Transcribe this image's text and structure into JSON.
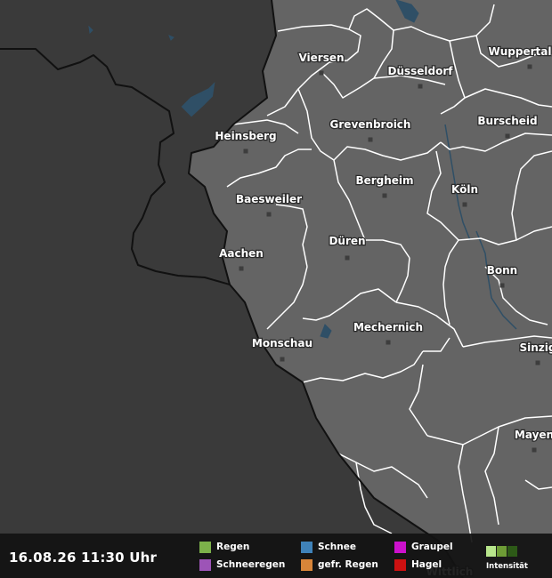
{
  "map": {
    "cities": [
      {
        "name": "Viersen"
      },
      {
        "name": "Düsseldorf"
      },
      {
        "name": "Wuppertal"
      },
      {
        "name": "Heinsberg"
      },
      {
        "name": "Grevenbroich"
      },
      {
        "name": "Burscheid"
      },
      {
        "name": "Bergheim"
      },
      {
        "name": "Baesweiler"
      },
      {
        "name": "Köln"
      },
      {
        "name": "Düren"
      },
      {
        "name": "Aachen"
      },
      {
        "name": "Bonn"
      },
      {
        "name": "Mechernich"
      },
      {
        "name": "Monschau"
      },
      {
        "name": "Sinzig"
      },
      {
        "name": "Mayen"
      },
      {
        "name": "Wittlich"
      }
    ],
    "colors": {
      "outside": "#3a3a3a",
      "germany": "#646464",
      "boundary": "#ffffff",
      "border": "#111111",
      "water": "#2f4f66"
    }
  },
  "footer": {
    "timestamp": "16.08.26 11:30 Uhr",
    "legend": [
      {
        "label": "Regen",
        "color": "#7cb14a"
      },
      {
        "label": "Schneeregen",
        "color": "#9d54b7"
      },
      {
        "label": "Schnee",
        "color": "#3f82b9"
      },
      {
        "label": "gefr. Regen",
        "color": "#d88539"
      },
      {
        "label": "Graupel",
        "color": "#cc11cc"
      },
      {
        "label": "Hagel",
        "color": "#cc1111"
      }
    ],
    "intensity": {
      "label": "Intensität",
      "colors": [
        "#b8e68c",
        "#6e9d36",
        "#2d5a17"
      ]
    }
  }
}
